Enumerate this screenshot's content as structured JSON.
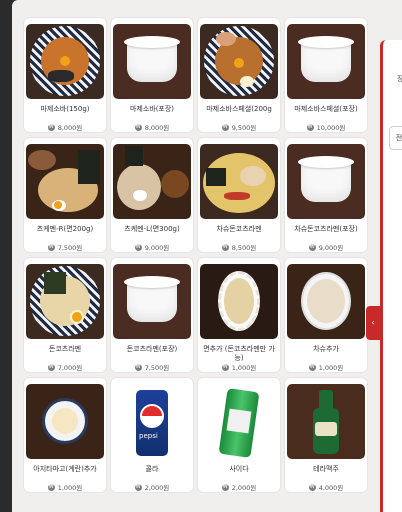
{
  "menu_items": [
    {
      "name": "마제소바(150g)",
      "price": "8,000원"
    },
    {
      "name": "마제소바(포장)",
      "price": "8,000원"
    },
    {
      "name": "마제소바스페셜(200g",
      "price": "9,500원"
    },
    {
      "name": "마제소바스페셜(포장)",
      "price": "10,000원"
    },
    {
      "name": "츠케멘-R(면200g)",
      "price": "7,500원"
    },
    {
      "name": "츠케멘-L(면300g)",
      "price": "9,000원"
    },
    {
      "name": "차슈돈코츠라멘",
      "price": "8,500원"
    },
    {
      "name": "차슈돈코츠라멘(포장)",
      "price": "9,000원"
    },
    {
      "name": "돈코츠라멘",
      "price": "7,000원"
    },
    {
      "name": "돈코츠라멘(포장)",
      "price": "7,500원"
    },
    {
      "name": "면추가 (돈코츠라멘만 가능)",
      "price": "1,000원"
    },
    {
      "name": "차슈추가",
      "price": "1,000원"
    },
    {
      "name": "아지타마고(계란)추가",
      "price": "1,000원"
    },
    {
      "name": "콜라",
      "price": "2,000원"
    },
    {
      "name": "사이다",
      "price": "2,000원"
    },
    {
      "name": "테라맥주",
      "price": "4,000원"
    }
  ],
  "currency_icon": "won-icon",
  "side_panel": {
    "label": "장",
    "button": "전"
  },
  "colors": {
    "accent": "#c82a2a",
    "background": "#f1efee",
    "card": "#ffffff"
  }
}
